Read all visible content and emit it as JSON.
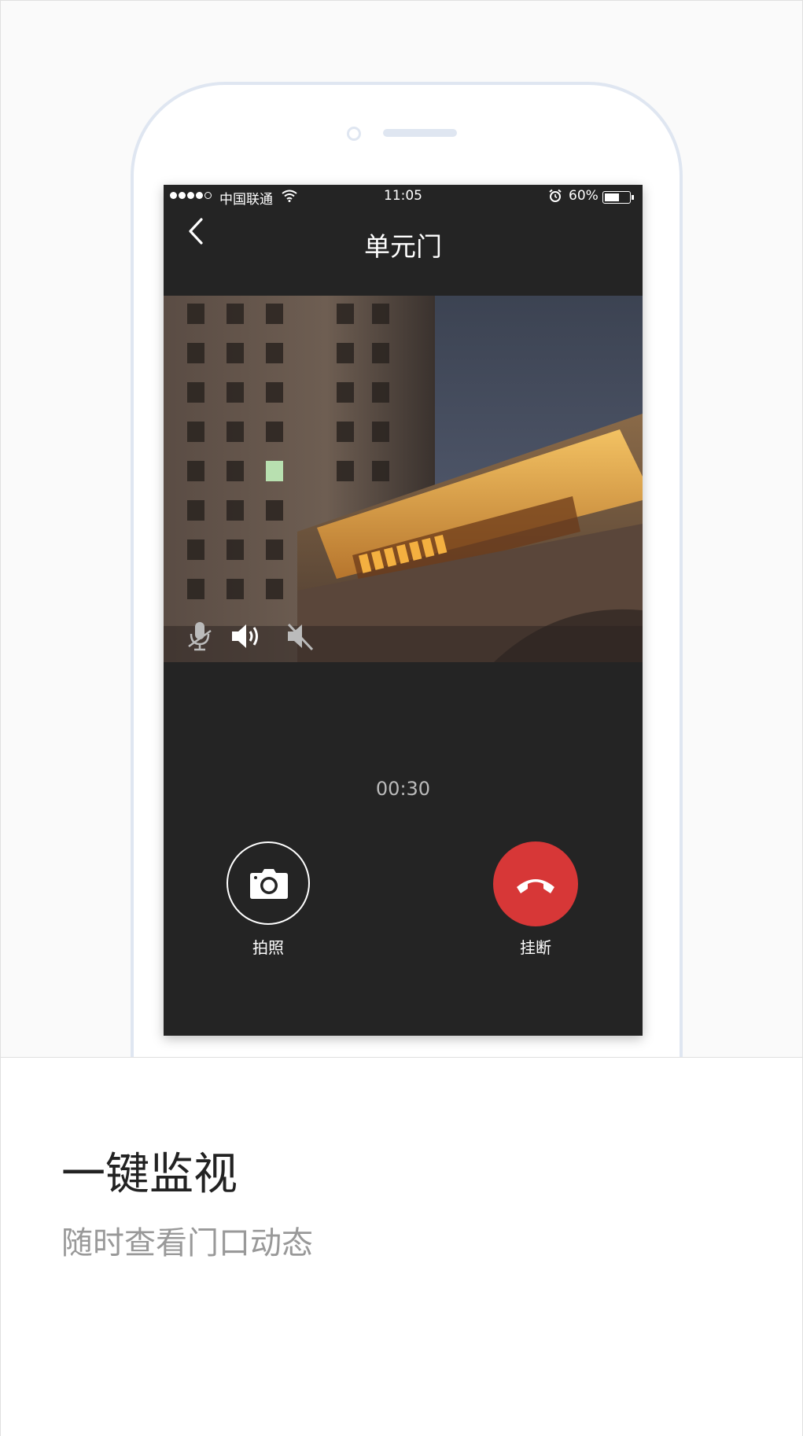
{
  "status_bar": {
    "carrier": "中国联通",
    "time": "11:05",
    "battery": "60%",
    "battery_level": 0.6
  },
  "header": {
    "title": "单元门",
    "back_icon": "chevron-left-icon"
  },
  "video": {
    "controls": [
      {
        "name": "mic-off-icon",
        "state": "disabled"
      },
      {
        "name": "speaker-on-icon",
        "state": "active"
      },
      {
        "name": "speaker-muted-icon",
        "state": "disabled"
      }
    ]
  },
  "call": {
    "timer": "00:30",
    "photo_label": "拍照",
    "hangup_label": "挂断"
  },
  "colors": {
    "screen_bg": "#242424",
    "hangup_red": "#d73737",
    "phone_outline": "#dfe6f1"
  },
  "feature": {
    "title": "一键监视",
    "subtitle": "随时查看门口动态"
  }
}
